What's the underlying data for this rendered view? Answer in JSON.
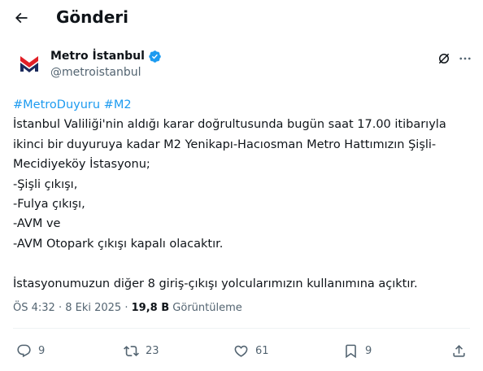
{
  "header": {
    "title": "Gönderi"
  },
  "author": {
    "display_name": "Metro İstanbul",
    "handle": "@metroistanbul"
  },
  "tweet": {
    "hashtag_line": "#MetroDuyuru #M2",
    "lines": [
      "İstanbul Valiliği'nin aldığı karar doğrultusunda bugün saat 17.00 itibarıyla",
      "ikinci bir duyuruya kadar M2 Yenikapı-Hacıosman Metro Hattımızın Şişli-",
      "Mecidiyeköy İstasyonu;",
      "-Şişli çıkışı,",
      "-Fulya çıkışı,",
      "-AVM ve",
      "-AVM Otopark çıkışı kapalı olacaktır."
    ],
    "last_line": "İstasyonumuzun diğer 8 giriş-çıkışı yolcularımızın kullanımına açıktır."
  },
  "meta": {
    "time": "ÖS 4:32",
    "separator": "·",
    "date": "8 Eki 2025",
    "views_count": "19,8 B",
    "views_label": "Görüntüleme"
  },
  "actions": {
    "replies": "9",
    "reposts": "23",
    "likes": "61",
    "bookmarks": "9"
  },
  "colors": {
    "accent": "#1d9bf0",
    "text": "#0f1419",
    "secondary": "#536471",
    "logo_red": "#e11f26",
    "logo_navy": "#1b2a5c"
  },
  "icons": [
    "back-arrow-icon",
    "verified-badge-icon",
    "grok-icon",
    "more-icon",
    "reply-icon",
    "repost-icon",
    "like-icon",
    "bookmark-icon",
    "share-icon"
  ]
}
